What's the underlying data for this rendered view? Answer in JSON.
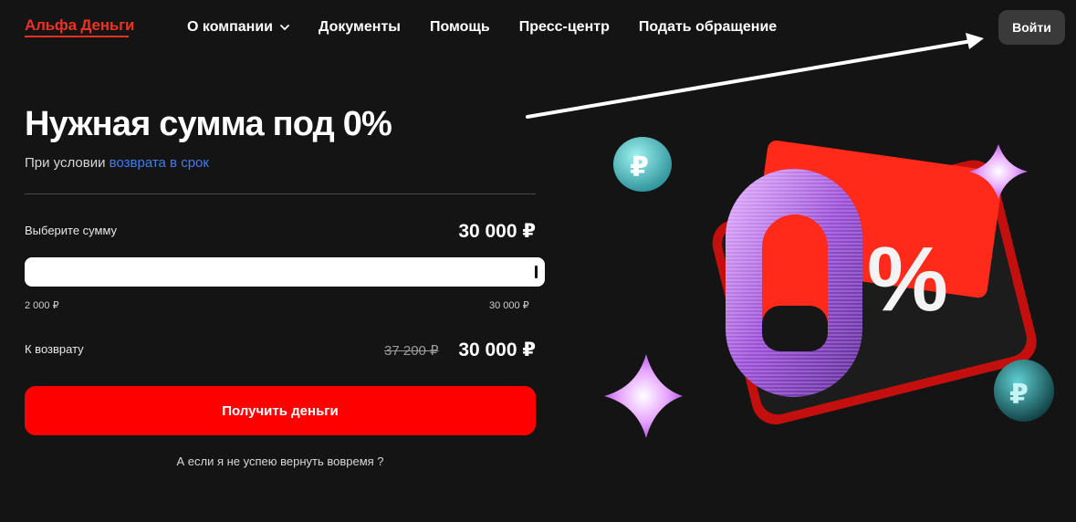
{
  "header": {
    "logo": "Альфа Деньги",
    "nav": [
      "О компании",
      "Документы",
      "Помощь",
      "Пресс-центр",
      "Подать обращение"
    ],
    "login_label": "Войти"
  },
  "hero": {
    "title": "Нужная сумма под 0%",
    "subtitle_prefix": "При условии ",
    "subtitle_link": "возврата в срок"
  },
  "calculator": {
    "select_label": "Выберите сумму",
    "selected_amount": "30 000 ₽",
    "slider_value_fraction": 1.0,
    "slider_min_label": "2 000 ₽",
    "slider_max_label": "30 000 ₽",
    "return_label": "К возврату",
    "old_return_amount": "37 200 ₽",
    "return_amount": "30 000 ₽"
  },
  "cta_label": "Получить деньги",
  "faq_link": "А если я не успею вернуть вовремя ?",
  "promo_art": {
    "big_digit": "0",
    "percent_sign": "%"
  },
  "colors": {
    "brand": "#ef3124",
    "cta": "#ff0000",
    "link": "#3d7ef0",
    "background": "#141414"
  }
}
